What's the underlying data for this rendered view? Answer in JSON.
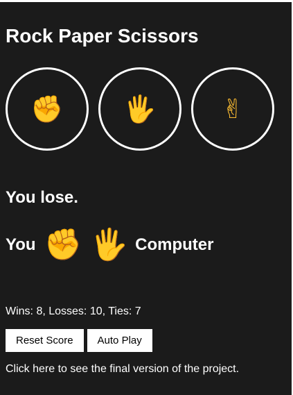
{
  "app": {
    "title": "Rock Paper Scissors"
  },
  "moves": [
    {
      "name": "rock",
      "icon": "✊"
    },
    {
      "name": "paper",
      "icon": "🖐"
    },
    {
      "name": "scissors",
      "icon": "✌"
    }
  ],
  "result": {
    "text": "You lose."
  },
  "picks": {
    "you_label": "You",
    "you_icon": "✊",
    "computer_icon": "🖐",
    "computer_label": "Computer"
  },
  "score": {
    "text": "Wins: 8, Losses: 10, Ties: 7"
  },
  "buttons": {
    "reset_label": "Reset Score",
    "auto_play_label": "Auto Play"
  },
  "footer": {
    "link_text": "Click here to see the final version of the project."
  },
  "colors": {
    "background": "#1b1b1b",
    "text": "#ffffff",
    "icon": "#f4b731"
  }
}
